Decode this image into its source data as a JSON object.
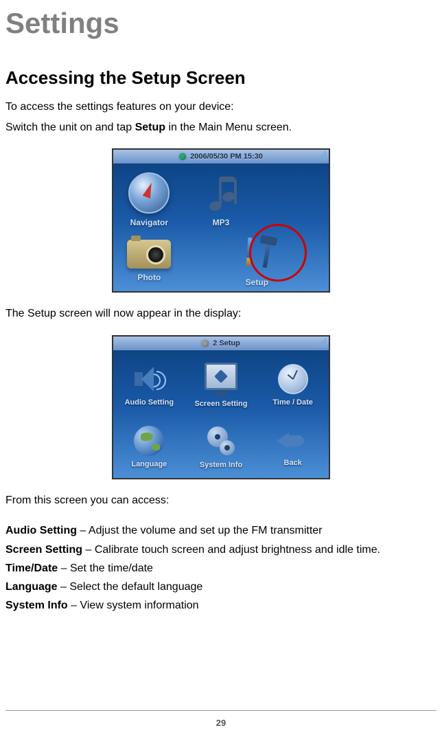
{
  "title": "Settings",
  "sectionHeading": "Accessing the Setup Screen",
  "intro1": "To access the settings features on your device:",
  "intro2_a": "Switch the unit on and tap ",
  "intro2_b": "Setup",
  "intro2_c": " in the Main Menu screen.",
  "mainMenu": {
    "datetime": "2006/05/30  PM 15:30",
    "items": {
      "navigator": "Navigator",
      "mp3": "MP3",
      "photo": "Photo",
      "setup": "Setup"
    }
  },
  "afterShot1": "The Setup screen will now appear in the display:",
  "setupMenu": {
    "titlebar": "2 Setup",
    "items": {
      "audio": "Audio Setting",
      "screen": "Screen Setting",
      "timedate": "Time / Date",
      "language": "Language",
      "sysinfo": "System Info",
      "back": "Back"
    }
  },
  "afterShot2": "From this screen you can access:",
  "options": [
    {
      "name": "Audio Setting",
      "desc": " – Adjust the volume and set up the FM transmitter"
    },
    {
      "name": "Screen Setting",
      "desc": " – Calibrate touch screen and adjust brightness and idle time."
    },
    {
      "name": "Time/Date",
      "desc": " – Set the time/date"
    },
    {
      "name": "Language",
      "desc": " – Select the default language"
    },
    {
      "name": "System Info",
      "desc": " – View system information"
    }
  ],
  "pageNumber": "29"
}
